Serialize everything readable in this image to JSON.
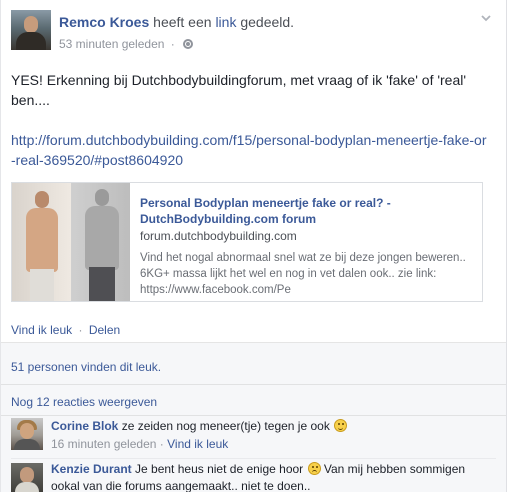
{
  "post": {
    "author": "Remco Kroes",
    "action_prefix": "heeft een",
    "action_link": "link",
    "action_suffix": "gedeeld.",
    "timestamp": "53 minuten geleden",
    "privacy_icon": "globe-icon",
    "menu_icon": "chevron-down-icon",
    "text": "YES! Erkenning bij Dutchbodybuildingforum, met vraag of ik 'fake' of 'real' ben....",
    "url": "http://forum.dutchbodybuilding.com/f15/personal-bodyplan-meneertje-fake-or-real-369520/#post8604920"
  },
  "link_preview": {
    "title": "Personal Bodyplan meneertje fake or real? - DutchBodybuilding.com forum",
    "domain": "forum.dutchbodybuilding.com",
    "description": "Vind het nogal abnormaal snel wat ze bij deze jongen beweren.. 6KG+ massa lijkt het wel en nog in vet dalen ook.. zie link: https://www.facebook.com/Pe"
  },
  "actions": {
    "like": "Vind ik leuk",
    "separator": "·",
    "share": "Delen"
  },
  "ufi": {
    "likes_summary": "51 personen vinden dit leuk.",
    "more_comments": "Nog 12 reacties weergeven"
  },
  "comments": [
    {
      "name": "Corine Blok",
      "text": "ze zeiden nog meneer(tje) tegen je ook",
      "emoticon": "smile",
      "time": "16 minuten geleden",
      "separator": "·",
      "like": "Vind ik leuk"
    },
    {
      "name": "Kenzie Durant",
      "text_before": "Je bent heus niet de enige hoor",
      "emoticon": "frown",
      "text_after": "Van mij hebben sommigen ookal van die forums aangemaakt.. niet te doen.."
    }
  ],
  "colors": {
    "link_blue": "#3b5998",
    "meta_gray": "#90949c",
    "ufi_background": "#f6f7f9"
  }
}
